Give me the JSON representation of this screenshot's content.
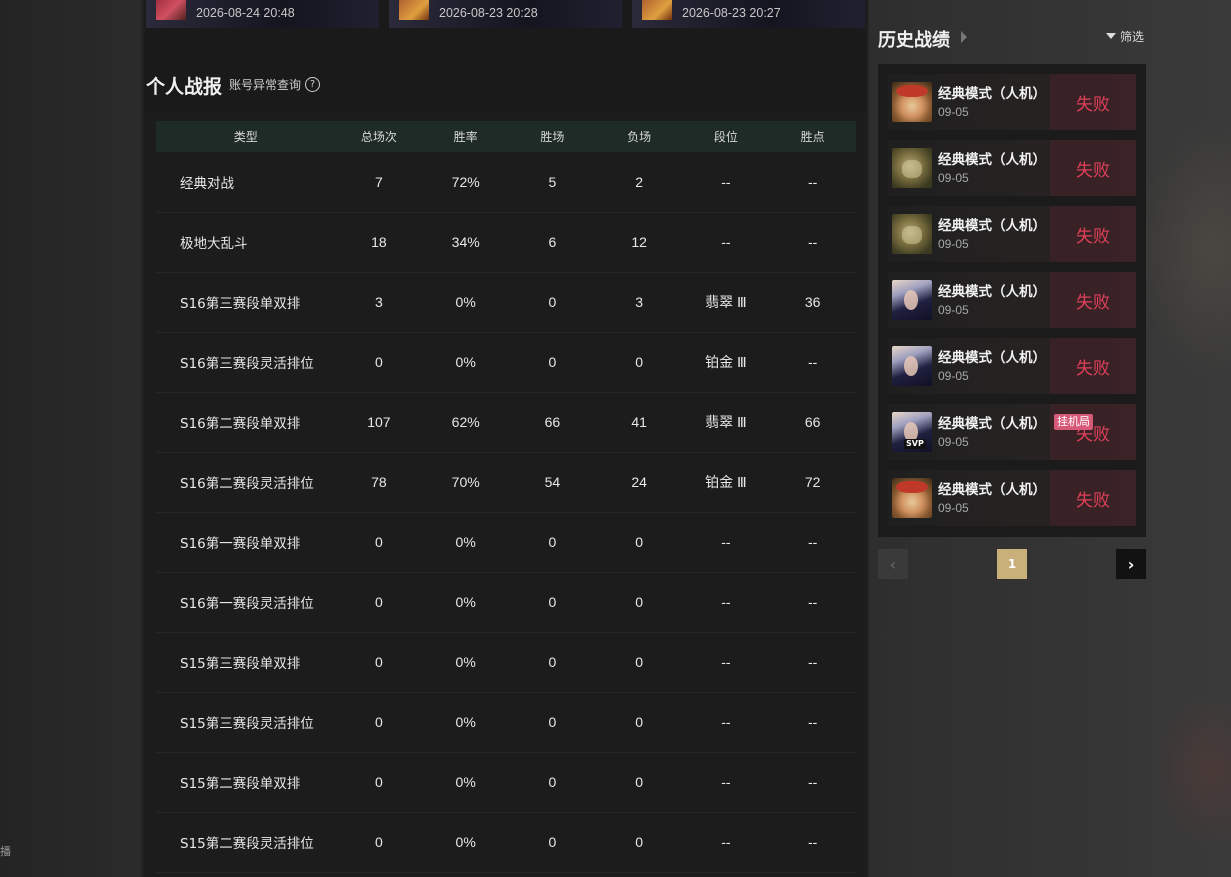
{
  "recent_matches": [
    {
      "time": "2026-08-24 20:48"
    },
    {
      "time": "2026-08-23 20:28"
    },
    {
      "time": "2026-08-23 20:27"
    }
  ],
  "personal": {
    "title": "个人战报",
    "abnormal_link": "账号异常查询",
    "help_icon": "?"
  },
  "table": {
    "headers": [
      "类型",
      "总场次",
      "胜率",
      "胜场",
      "负场",
      "段位",
      "胜点"
    ],
    "rows": [
      [
        "经典对战",
        "7",
        "72%",
        "5",
        "2",
        "--",
        "--"
      ],
      [
        "极地大乱斗",
        "18",
        "34%",
        "6",
        "12",
        "--",
        "--"
      ],
      [
        "S16第三赛段单双排",
        "3",
        "0%",
        "0",
        "3",
        "翡翠 Ⅲ",
        "36"
      ],
      [
        "S16第三赛段灵活排位",
        "0",
        "0%",
        "0",
        "0",
        "铂金 Ⅲ",
        "--"
      ],
      [
        "S16第二赛段单双排",
        "107",
        "62%",
        "66",
        "41",
        "翡翠 Ⅲ",
        "66"
      ],
      [
        "S16第二赛段灵活排位",
        "78",
        "70%",
        "54",
        "24",
        "铂金 Ⅲ",
        "72"
      ],
      [
        "S16第一赛段单双排",
        "0",
        "0%",
        "0",
        "0",
        "--",
        "--"
      ],
      [
        "S16第一赛段灵活排位",
        "0",
        "0%",
        "0",
        "0",
        "--",
        "--"
      ],
      [
        "S15第三赛段单双排",
        "0",
        "0%",
        "0",
        "0",
        "--",
        "--"
      ],
      [
        "S15第三赛段灵活排位",
        "0",
        "0%",
        "0",
        "0",
        "--",
        "--"
      ],
      [
        "S15第二赛段单双排",
        "0",
        "0%",
        "0",
        "0",
        "--",
        "--"
      ],
      [
        "S15第二赛段灵活排位",
        "0",
        "0%",
        "0",
        "0",
        "--",
        "--"
      ]
    ]
  },
  "history": {
    "title": "历史战绩",
    "filter_label": "筛选",
    "matches": [
      {
        "mode": "经典模式（人机）",
        "date": "09-05",
        "result": "失败",
        "avatar": "teemo"
      },
      {
        "mode": "经典模式（人机）",
        "date": "09-05",
        "result": "失败",
        "avatar": "rammus"
      },
      {
        "mode": "经典模式（人机）",
        "date": "09-05",
        "result": "失败",
        "avatar": "rammus"
      },
      {
        "mode": "经典模式（人机）",
        "date": "09-05",
        "result": "失败",
        "avatar": "evelynn"
      },
      {
        "mode": "经典模式（人机）",
        "date": "09-05",
        "result": "失败",
        "avatar": "evelynn"
      },
      {
        "mode": "经典模式（人机）",
        "date": "09-05",
        "result": "失败",
        "avatar": "evelynn",
        "badge": "挂机局",
        "svp": "SVP"
      },
      {
        "mode": "经典模式（人机）",
        "date": "09-05",
        "result": "失败",
        "avatar": "teemo"
      }
    ]
  },
  "pager": {
    "prev": "‹",
    "current": "1",
    "next": "›"
  },
  "edge_text": "播",
  "colors": {
    "loss": "#e0405a",
    "page_active": "#c9b07a",
    "header_bg": "#1e2b27"
  }
}
